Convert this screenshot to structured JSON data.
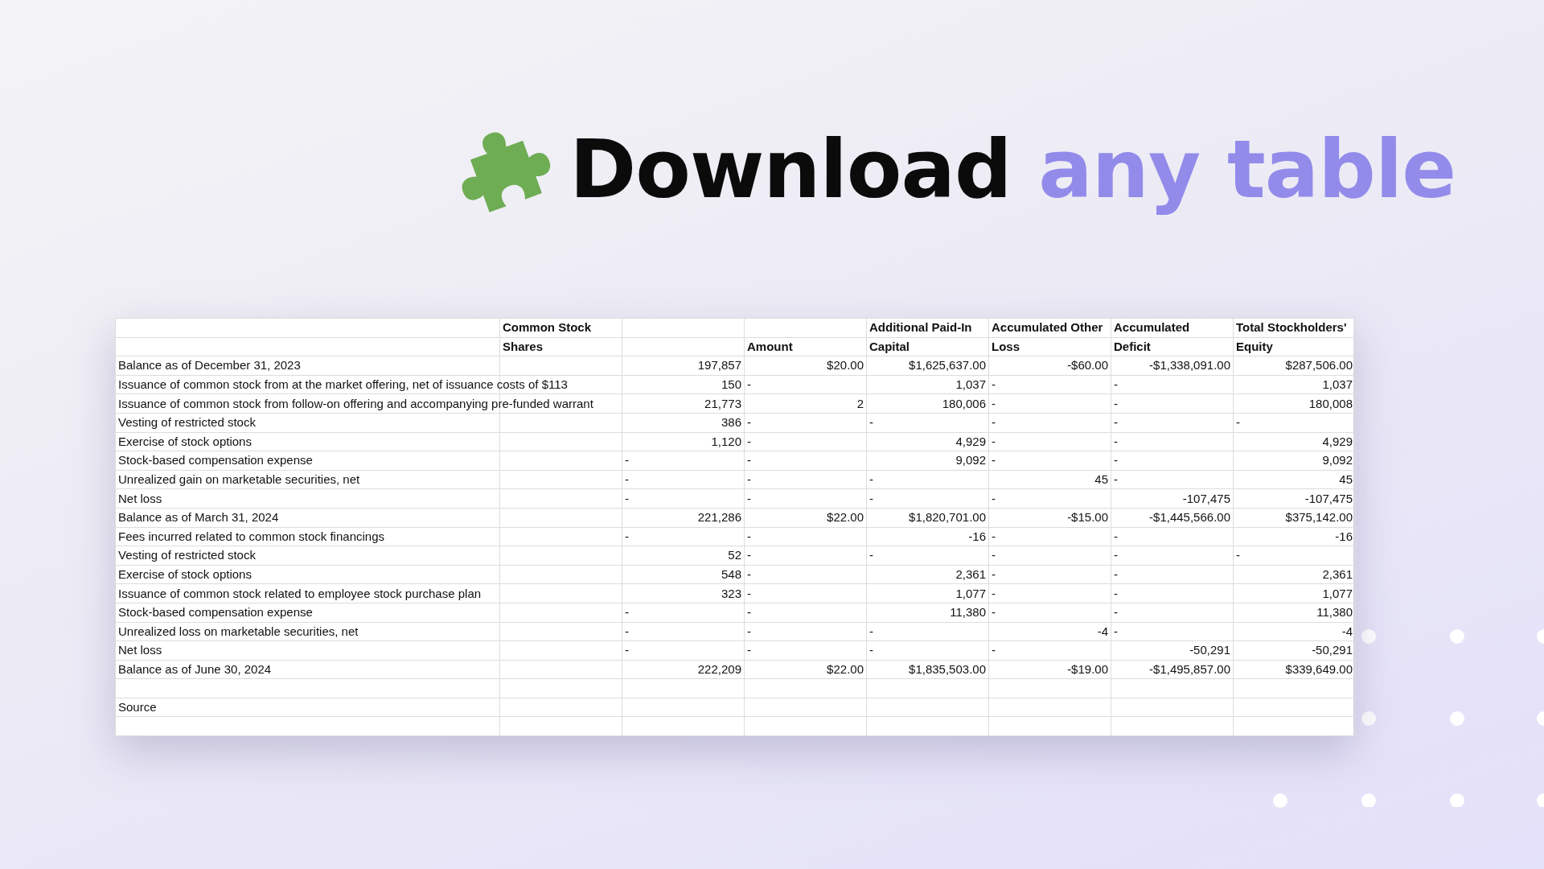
{
  "headline": {
    "lead": "Download",
    "accent": "any table"
  },
  "table": {
    "header_rows": [
      [
        "",
        "Common Stock",
        "",
        "",
        "Additional Paid-In",
        "Accumulated Other",
        "Accumulated",
        "Total Stockholders'"
      ],
      [
        "",
        "Shares",
        "",
        "Amount",
        "Capital",
        "Loss",
        "Deficit",
        "Equity"
      ]
    ],
    "rows": [
      {
        "label": "Balance as of December 31, 2023",
        "cells": [
          null,
          {
            "text": "197,857",
            "kind": "number"
          },
          {
            "text": "$20.00",
            "kind": "number"
          },
          {
            "text": "$1,625,637.00",
            "kind": "number"
          },
          {
            "text": "-$60.00",
            "kind": "number"
          },
          {
            "text": "-$1,338,091.00",
            "kind": "number"
          },
          {
            "text": "$287,506.00",
            "kind": "number"
          }
        ]
      },
      {
        "label": "Issuance of common stock from at the market offering, net of issuance costs of $113",
        "cells": [
          null,
          {
            "text": "150",
            "kind": "number"
          },
          {
            "text": "-",
            "kind": "text"
          },
          {
            "text": "1,037",
            "kind": "number"
          },
          {
            "text": "-",
            "kind": "text"
          },
          {
            "text": "-",
            "kind": "text"
          },
          {
            "text": "1,037",
            "kind": "number"
          }
        ]
      },
      {
        "label": "Issuance of common stock from follow-on offering and accompanying pre-funded warrant",
        "cells": [
          null,
          {
            "text": "21,773",
            "kind": "number"
          },
          {
            "text": "2",
            "kind": "number"
          },
          {
            "text": "180,006",
            "kind": "number"
          },
          {
            "text": "-",
            "kind": "text"
          },
          {
            "text": "-",
            "kind": "text"
          },
          {
            "text": "180,008",
            "kind": "number"
          }
        ]
      },
      {
        "label": "Vesting of restricted stock",
        "cells": [
          null,
          {
            "text": "386",
            "kind": "number"
          },
          {
            "text": "-",
            "kind": "text"
          },
          {
            "text": "-",
            "kind": "text"
          },
          {
            "text": "-",
            "kind": "text"
          },
          {
            "text": "-",
            "kind": "text"
          },
          {
            "text": "-",
            "kind": "text"
          }
        ]
      },
      {
        "label": "Exercise of stock options",
        "cells": [
          null,
          {
            "text": "1,120",
            "kind": "number"
          },
          {
            "text": "-",
            "kind": "text"
          },
          {
            "text": "4,929",
            "kind": "number"
          },
          {
            "text": "-",
            "kind": "text"
          },
          {
            "text": "-",
            "kind": "text"
          },
          {
            "text": "4,929",
            "kind": "number"
          }
        ]
      },
      {
        "label": "Stock-based compensation expense",
        "cells": [
          null,
          {
            "text": "-",
            "kind": "text"
          },
          {
            "text": "-",
            "kind": "text"
          },
          {
            "text": "9,092",
            "kind": "number"
          },
          {
            "text": "-",
            "kind": "text"
          },
          {
            "text": "-",
            "kind": "text"
          },
          {
            "text": "9,092",
            "kind": "number"
          }
        ]
      },
      {
        "label": "Unrealized gain on marketable securities, net",
        "cells": [
          null,
          {
            "text": "-",
            "kind": "text"
          },
          {
            "text": "-",
            "kind": "text"
          },
          {
            "text": "-",
            "kind": "text"
          },
          {
            "text": "45",
            "kind": "number"
          },
          {
            "text": "-",
            "kind": "text"
          },
          {
            "text": "45",
            "kind": "number"
          }
        ]
      },
      {
        "label": "Net loss",
        "cells": [
          null,
          {
            "text": "-",
            "kind": "text"
          },
          {
            "text": "-",
            "kind": "text"
          },
          {
            "text": "-",
            "kind": "text"
          },
          {
            "text": "-",
            "kind": "text"
          },
          {
            "text": "-107,475",
            "kind": "number"
          },
          {
            "text": "-107,475",
            "kind": "number"
          }
        ]
      },
      {
        "label": "Balance as of March 31, 2024",
        "cells": [
          null,
          {
            "text": "221,286",
            "kind": "number"
          },
          {
            "text": "$22.00",
            "kind": "number"
          },
          {
            "text": "$1,820,701.00",
            "kind": "number"
          },
          {
            "text": "-$15.00",
            "kind": "number"
          },
          {
            "text": "-$1,445,566.00",
            "kind": "number"
          },
          {
            "text": "$375,142.00",
            "kind": "number"
          }
        ]
      },
      {
        "label": "Fees incurred related to common stock financings",
        "cells": [
          null,
          {
            "text": "-",
            "kind": "text"
          },
          {
            "text": "-",
            "kind": "text"
          },
          {
            "text": "-16",
            "kind": "number"
          },
          {
            "text": "-",
            "kind": "text"
          },
          {
            "text": "-",
            "kind": "text"
          },
          {
            "text": "-16",
            "kind": "number"
          }
        ]
      },
      {
        "label": "Vesting of restricted stock",
        "cells": [
          null,
          {
            "text": "52",
            "kind": "number"
          },
          {
            "text": "-",
            "kind": "text"
          },
          {
            "text": "-",
            "kind": "text"
          },
          {
            "text": "-",
            "kind": "text"
          },
          {
            "text": "-",
            "kind": "text"
          },
          {
            "text": "-",
            "kind": "text"
          }
        ]
      },
      {
        "label": "Exercise of stock options",
        "cells": [
          null,
          {
            "text": "548",
            "kind": "number"
          },
          {
            "text": "-",
            "kind": "text"
          },
          {
            "text": "2,361",
            "kind": "number"
          },
          {
            "text": "-",
            "kind": "text"
          },
          {
            "text": "-",
            "kind": "text"
          },
          {
            "text": "2,361",
            "kind": "number"
          }
        ]
      },
      {
        "label": "Issuance of common stock related to employee stock purchase plan",
        "cells": [
          null,
          {
            "text": "323",
            "kind": "number"
          },
          {
            "text": "-",
            "kind": "text"
          },
          {
            "text": "1,077",
            "kind": "number"
          },
          {
            "text": "-",
            "kind": "text"
          },
          {
            "text": "-",
            "kind": "text"
          },
          {
            "text": "1,077",
            "kind": "number"
          }
        ]
      },
      {
        "label": "Stock-based compensation expense",
        "cells": [
          null,
          {
            "text": "-",
            "kind": "text"
          },
          {
            "text": "-",
            "kind": "text"
          },
          {
            "text": "11,380",
            "kind": "number"
          },
          {
            "text": "-",
            "kind": "text"
          },
          {
            "text": "-",
            "kind": "text"
          },
          {
            "text": "11,380",
            "kind": "number"
          }
        ]
      },
      {
        "label": "Unrealized loss on marketable securities, net",
        "cells": [
          null,
          {
            "text": "-",
            "kind": "text"
          },
          {
            "text": "-",
            "kind": "text"
          },
          {
            "text": "-",
            "kind": "text"
          },
          {
            "text": "-4",
            "kind": "number"
          },
          {
            "text": "-",
            "kind": "text"
          },
          {
            "text": "-4",
            "kind": "number"
          }
        ]
      },
      {
        "label": "Net loss",
        "cells": [
          null,
          {
            "text": "-",
            "kind": "text"
          },
          {
            "text": "-",
            "kind": "text"
          },
          {
            "text": "-",
            "kind": "text"
          },
          {
            "text": "-",
            "kind": "text"
          },
          {
            "text": "-50,291",
            "kind": "number"
          },
          {
            "text": "-50,291",
            "kind": "number"
          }
        ]
      },
      {
        "label": "Balance as of June 30, 2024",
        "cells": [
          null,
          {
            "text": "222,209",
            "kind": "number"
          },
          {
            "text": "$22.00",
            "kind": "number"
          },
          {
            "text": "$1,835,503.00",
            "kind": "number"
          },
          {
            "text": "-$19.00",
            "kind": "number"
          },
          {
            "text": "-$1,495,857.00",
            "kind": "number"
          },
          {
            "text": "$339,649.00",
            "kind": "number"
          }
        ]
      },
      {
        "label": "",
        "cells": []
      },
      {
        "label": "Source",
        "cells": []
      },
      {
        "label": "",
        "cells": []
      }
    ]
  }
}
